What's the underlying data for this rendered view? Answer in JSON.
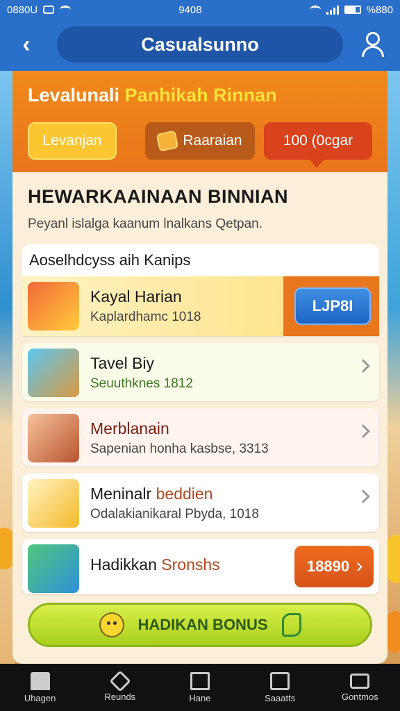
{
  "status_bar": {
    "carrier": "0880U",
    "time": "9408",
    "battery": "%880"
  },
  "header": {
    "title": "Casualsunno"
  },
  "card": {
    "title_main": "Levalunali",
    "title_highlight": "Panhikah Rinnan",
    "chips": [
      "Levanjan",
      "Raaraian",
      "100 (0cgar"
    ],
    "section_heading": "HEWARKAAINAAN BINNIAN",
    "section_subtitle": "Peyanl islalga kaanum lnalkans Qetpan."
  },
  "list": {
    "header": "Aoselhdcyss aih Kanips",
    "items": [
      {
        "title": "Kayal Harian",
        "subtitle": "Kaplardhamc 1018",
        "action": "LJP8I"
      },
      {
        "title": "Tavel Biy",
        "subtitle": "Seuuthknes 1812"
      },
      {
        "title": "Merblanain",
        "subtitle": "Sapenian honha kasbse, 3313"
      },
      {
        "title": "Meninalr",
        "title_accent": "beddien",
        "subtitle": "Odalakianikaral Pbyda, 1018"
      },
      {
        "title": "Hadikkan",
        "title_accent": "Sronshs",
        "action": "18890"
      }
    ]
  },
  "bonus_button": {
    "label": "HADIKAN BONUS"
  },
  "bottom_nav": [
    {
      "label": "Uhagen",
      "icon": "home-icon"
    },
    {
      "label": "Reunds",
      "icon": "rewards-icon"
    },
    {
      "label": "Hane",
      "icon": "house-icon"
    },
    {
      "label": "Saaatts",
      "icon": "checkbox-icon"
    },
    {
      "label": "Gontmos",
      "icon": "game-icon"
    }
  ],
  "colors": {
    "header_blue": "#2a6fc9",
    "card_orange": "#e9751a",
    "accent_yellow": "#ffe23a",
    "bonus_green": "#a8cf1e",
    "price_orange": "#d6531a"
  }
}
